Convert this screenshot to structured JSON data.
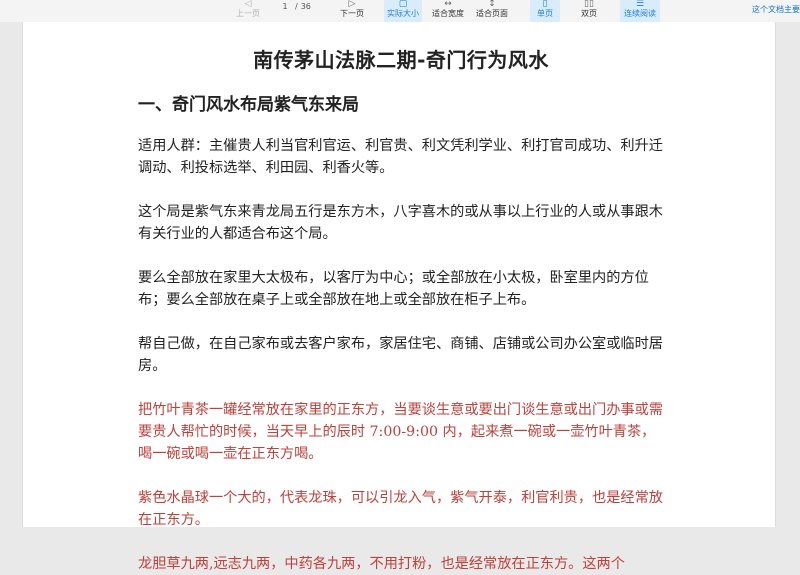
{
  "toolbar": {
    "prev_page": "上一页",
    "current_page": "1",
    "separator": "/",
    "total_pages": "36",
    "next_page": "下一页",
    "actual_size": "实际大小",
    "fit_width": "适合宽度",
    "fit_page": "适合页面",
    "single_page": "单页",
    "double_page": "双页",
    "continuous": "连续阅读",
    "doc_link": "这个文档主要"
  },
  "document": {
    "title": "南传茅山法脉二期-奇门行为风水",
    "section_heading": "一、奇门风水布局紫气东来局",
    "paragraphs": [
      {
        "text": "适用人群：主催贵人利当官利官运、利官贵、利文凭利学业、利打官司成功、利升迁调动、利投标选举、利田园、利香火等。",
        "color": "normal"
      },
      {
        "text": "这个局是紫气东来青龙局五行是东方木，八字喜木的或从事以上行业的人或从事跟木有关行业的人都适合布这个局。",
        "color": "normal"
      },
      {
        "text": "要么全部放在家里大太极布，以客厅为中心；或全部放在小太极，卧室里内的方位布；要么全部放在桌子上或全部放在地上或全部放在柜子上布。",
        "color": "normal"
      },
      {
        "text": "帮自己做，在自己家布或去客户家布，家居住宅、商铺、店铺或公司办公室或临时居房。",
        "color": "normal"
      },
      {
        "text": "把竹叶青茶一罐经常放在家里的正东方，当要谈生意或要出门谈生意或出门办事或需要贵人帮忙的时候，当天早上的辰时 7:00-9:00 内，起来煮一碗或一壶竹叶青茶，喝一碗或喝一壶在正东方喝。",
        "color": "red"
      },
      {
        "text": "紫色水晶球一个大的，代表龙珠，可以引龙入气，紫气开泰，利官利贵，也是经常放在正东方。",
        "color": "red"
      },
      {
        "text": "龙胆草九两,远志九两，中药各九两，不用打粉，也是经常放在正东方。这两个",
        "color": "red"
      }
    ]
  }
}
